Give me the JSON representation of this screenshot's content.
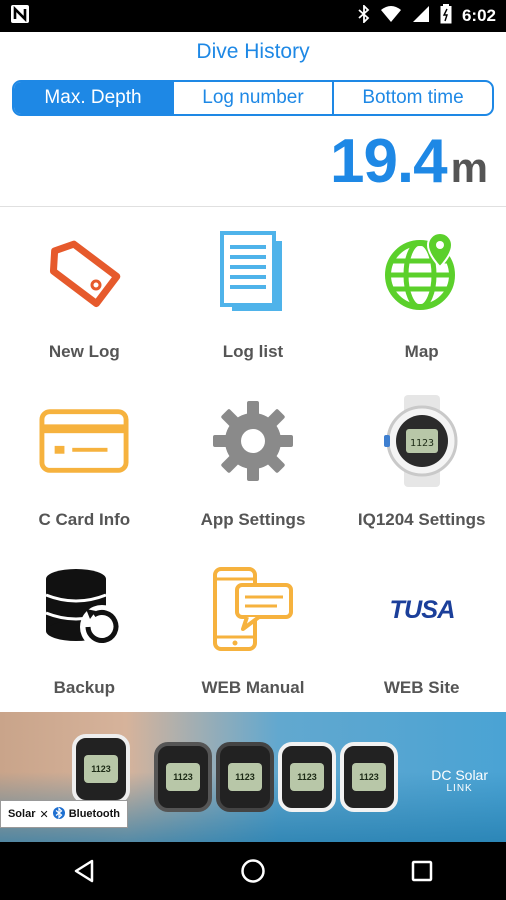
{
  "status_bar": {
    "time": "6:02",
    "notification_icon": "n-logo-icon"
  },
  "header": {
    "title": "Dive History"
  },
  "tabs": [
    {
      "label": "Max. Depth",
      "active": true
    },
    {
      "label": "Log number",
      "active": false
    },
    {
      "label": "Bottom time",
      "active": false
    }
  ],
  "metric": {
    "value": "19.4",
    "unit": "m"
  },
  "menu": [
    {
      "label": "New Log",
      "icon": "tag-icon"
    },
    {
      "label": "Log list",
      "icon": "document-list-icon"
    },
    {
      "label": "Map",
      "icon": "globe-pin-icon"
    },
    {
      "label": "C Card Info",
      "icon": "card-icon"
    },
    {
      "label": "App Settings",
      "icon": "gear-icon"
    },
    {
      "label": "IQ1204 Settings",
      "icon": "dive-watch-icon"
    },
    {
      "label": "Backup",
      "icon": "database-restore-icon"
    },
    {
      "label": "WEB Manual",
      "icon": "phone-chat-icon"
    },
    {
      "label": "WEB Site",
      "icon": "tusa-logo"
    }
  ],
  "banner": {
    "badge_left": "Solar",
    "badge_right": "Bluetooth",
    "brand_line1": "DC Solar",
    "brand_line2": "LINK",
    "watch_screen": "1123"
  },
  "colors": {
    "accent": "#1e88e5",
    "tag": "#e65a2c",
    "docs": "#4fb3ea",
    "globe": "#5bd02b",
    "card": "#f6b23e",
    "gear": "#8a8a8a",
    "tusa": "#1b3f9a"
  }
}
